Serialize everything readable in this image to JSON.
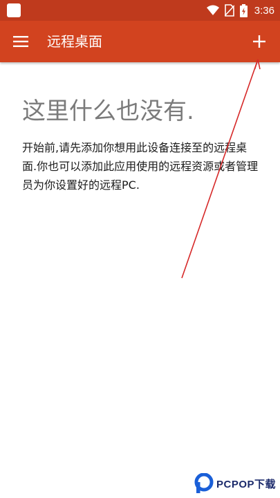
{
  "status_bar": {
    "time": "3:36",
    "icons": [
      "app-icon",
      "wifi-icon",
      "no-sim-icon",
      "battery-icon"
    ]
  },
  "app_bar": {
    "title": "远程桌面",
    "menu_icon": "hamburger-menu-icon",
    "add_icon": "plus-icon"
  },
  "content": {
    "heading": "这里什么也没有.",
    "description": "开始前,请先添加你想用此设备连接至的远程桌面.你也可以添加此应用使用的远程资源或者管理员为你设置好的远程PC."
  },
  "watermark": {
    "text": "PCPOP下载"
  },
  "colors": {
    "status_bar": "#bf3a1d",
    "app_bar": "#d2431f",
    "heading": "#7a7a7a",
    "body_text": "#1a1a1a",
    "annotation": "#d62828",
    "watermark": "#1b2a6b"
  }
}
